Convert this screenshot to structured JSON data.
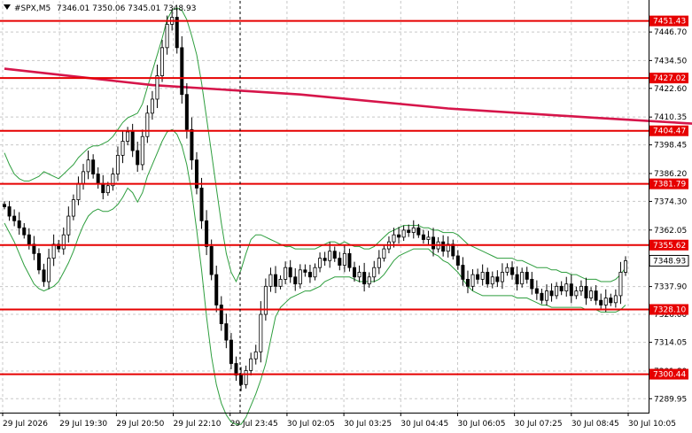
{
  "header": {
    "symbol": "#SPX,M5",
    "ohlc": "7346.01 7350.06 7345.01 7348.93"
  },
  "colors": {
    "background": "#ffffff",
    "candle": "#000000",
    "bands": "#2e9e3e",
    "ma": "#d6154a",
    "levels": "#e60000",
    "label_bg": "#e60000",
    "label_text": "#ffffff",
    "current_bg": "#ffffff",
    "current_text": "#000000",
    "grid": "#c8c8c8"
  },
  "chart_data": {
    "type": "candlestick",
    "timeframe": "M5",
    "grid": true,
    "ylim": [
      7284,
      7460
    ],
    "price_ticks": [
      "7446.70",
      "7434.50",
      "7422.60",
      "7410.35",
      "7398.45",
      "7386.20",
      "7374.30",
      "7362.05",
      "7337.90",
      "7326.00",
      "7314.05",
      "7301.80",
      "7289.95"
    ],
    "time_ticks": [
      "29 Jul 2026",
      "29 Jul 19:30",
      "29 Jul 20:50",
      "29 Jul 22:10",
      "29 Jul 23:45",
      "30 Jul 02:05",
      "30 Jul 03:25",
      "30 Jul 04:45",
      "30 Jul 06:05",
      "30 Jul 07:25",
      "30 Jul 08:45",
      "30 Jul 10:05"
    ],
    "levels": [
      {
        "value": 7451.43,
        "label": "7451.43"
      },
      {
        "value": 7427.02,
        "label": "7427.02"
      },
      {
        "value": 7404.47,
        "label": "7404.47"
      },
      {
        "value": 7381.79,
        "label": "7381.79"
      },
      {
        "value": 7355.62,
        "label": "7355.62"
      },
      {
        "value": 7328.1,
        "label": "7328.10"
      },
      {
        "value": 7300.44,
        "label": "7300.44"
      }
    ],
    "current_price": {
      "value": 7348.93,
      "label": "7348.93"
    },
    "closes": [
      7372,
      7368,
      7366,
      7363,
      7360,
      7356,
      7352,
      7345,
      7340,
      7350,
      7356,
      7354,
      7360,
      7368,
      7375,
      7382,
      7387,
      7392,
      7386,
      7382,
      7378,
      7381,
      7386,
      7394,
      7400,
      7404,
      7396,
      7390,
      7402,
      7412,
      7418,
      7428,
      7440,
      7450,
      7453,
      7440,
      7420,
      7405,
      7392,
      7380,
      7366,
      7355,
      7343,
      7330,
      7322,
      7315,
      7305,
      7300,
      7296,
      7302,
      7307,
      7310,
      7326,
      7338,
      7343,
      7338,
      7341,
      7346,
      7342,
      7339,
      7345,
      7344,
      7342,
      7346,
      7350,
      7349,
      7353,
      7350,
      7347,
      7352,
      7346,
      7342,
      7344,
      7339,
      7342,
      7346,
      7350,
      7354,
      7357,
      7360,
      7359,
      7362,
      7361,
      7363,
      7360,
      7358,
      7359,
      7354,
      7357,
      7353,
      7356,
      7351,
      7347,
      7341,
      7338,
      7343,
      7341,
      7344,
      7339,
      7342,
      7340,
      7344,
      7346,
      7343,
      7339,
      7344,
      7341,
      7337,
      7335,
      7332,
      7336,
      7334,
      7338,
      7336,
      7339,
      7334,
      7336,
      7338,
      7333,
      7336,
      7332,
      7330,
      7333,
      7331,
      7334,
      7344,
      7348.93
    ],
    "upper_band": [
      7395,
      7390,
      7386,
      7384,
      7383,
      7383,
      7384,
      7385,
      7387,
      7386,
      7385,
      7384,
      7386,
      7388,
      7390,
      7393,
      7395,
      7397,
      7398,
      7398,
      7399,
      7400,
      7402,
      7405,
      7408,
      7410,
      7411,
      7412,
      7416,
      7423,
      7430,
      7437,
      7444,
      7452,
      7456,
      7457,
      7456,
      7452,
      7445,
      7437,
      7425,
      7410,
      7395,
      7380,
      7365,
      7352,
      7344,
      7340,
      7345,
      7352,
      7358,
      7360,
      7360,
      7359,
      7358,
      7357,
      7356,
      7355,
      7355,
      7354,
      7354,
      7354,
      7354,
      7354,
      7355,
      7356,
      7357,
      7357,
      7356,
      7357,
      7356,
      7355,
      7355,
      7354,
      7354,
      7355,
      7357,
      7359,
      7361,
      7362,
      7363,
      7364,
      7364,
      7364,
      7364,
      7363,
      7363,
      7362,
      7362,
      7361,
      7361,
      7361,
      7360,
      7358,
      7356,
      7355,
      7354,
      7353,
      7352,
      7351,
      7350,
      7350,
      7350,
      7350,
      7349,
      7349,
      7348,
      7347,
      7346,
      7346,
      7346,
      7345,
      7345,
      7344,
      7344,
      7343,
      7343,
      7342,
      7341,
      7341,
      7341,
      7340,
      7340,
      7340,
      7341,
      7343,
      7346
    ],
    "lower_band": [
      7365,
      7361,
      7357,
      7352,
      7347,
      7343,
      7339,
      7337,
      7336,
      7337,
      7338,
      7340,
      7344,
      7348,
      7353,
      7359,
      7364,
      7368,
      7370,
      7371,
      7370,
      7370,
      7371,
      7373,
      7376,
      7380,
      7378,
      7374,
      7378,
      7385,
      7390,
      7395,
      7400,
      7404,
      7405,
      7403,
      7398,
      7390,
      7378,
      7362,
      7345,
      7325,
      7308,
      7296,
      7288,
      7283,
      7280,
      7279,
      7279,
      7282,
      7287,
      7292,
      7298,
      7305,
      7315,
      7325,
      7329,
      7331,
      7333,
      7334,
      7335,
      7336,
      7336,
      7337,
      7338,
      7340,
      7341,
      7342,
      7342,
      7342,
      7342,
      7341,
      7340,
      7340,
      7340,
      7340,
      7341,
      7343,
      7346,
      7349,
      7351,
      7352,
      7353,
      7354,
      7354,
      7354,
      7354,
      7352,
      7351,
      7349,
      7348,
      7346,
      7344,
      7341,
      7338,
      7336,
      7335,
      7334,
      7334,
      7334,
      7334,
      7334,
      7334,
      7334,
      7333,
      7333,
      7333,
      7332,
      7331,
      7330,
      7330,
      7329,
      7329,
      7329,
      7329,
      7329,
      7329,
      7329,
      7328,
      7328,
      7328,
      7327,
      7327,
      7327,
      7327,
      7328,
      7330
    ],
    "ma": [
      [
        0,
        7431
      ],
      [
        30,
        7424
      ],
      [
        60,
        7420
      ],
      [
        90,
        7414
      ],
      [
        120,
        7410
      ],
      [
        160,
        7405
      ],
      [
        200,
        7400
      ],
      [
        240,
        7394
      ],
      [
        280,
        7388
      ],
      [
        310,
        7382
      ],
      [
        340,
        7376
      ],
      [
        370,
        7370
      ],
      [
        396,
        7363
      ],
      [
        410,
        7358
      ]
    ]
  }
}
